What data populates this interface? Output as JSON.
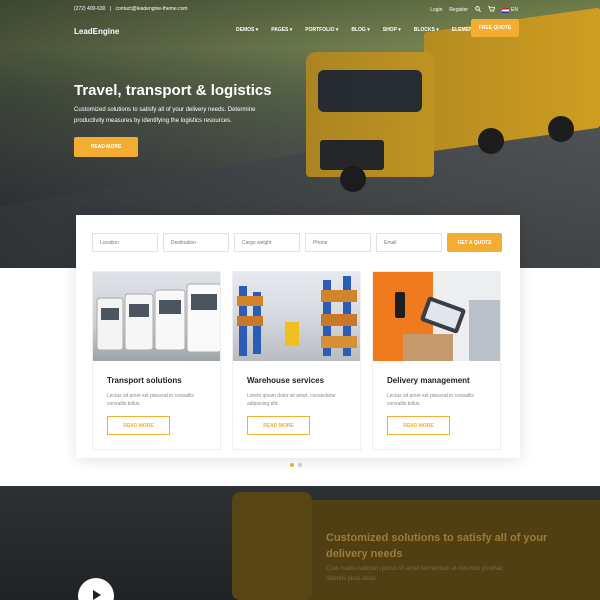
{
  "topbar": {
    "phone": "(272) 400-630",
    "email": "contact@leadengine-theme.com",
    "login": "Login",
    "register": "Register",
    "lang": "EN"
  },
  "nav": {
    "logo": "LeadEngine",
    "items": [
      "DEMOS",
      "PAGES",
      "PORTFOLIO",
      "BLOG",
      "SHOP",
      "BLOCKS",
      "ELEMENTS"
    ],
    "cta": "FREE QUOTE"
  },
  "hero": {
    "title": "Travel, transport & logistics",
    "subtitle": "Customized solutions to satisfy all of your delivery needs. Determine productivity measures by identifying the logistics resources.",
    "button": "READ MORE"
  },
  "quote_form": {
    "location": "Location",
    "destination": "Destination",
    "cargo_weight": "Cargo weight",
    "phone": "Phone",
    "email": "Email",
    "button": "GET A QUOTE"
  },
  "cards": [
    {
      "title": "Transport solutions",
      "text": "Lectus sit amet est placerat in convallis convallis tellus.",
      "button": "READ MORE"
    },
    {
      "title": "Warehouse services",
      "text": "Lorem ipsum dolor sit amet, consectetur adipiscing elit.",
      "button": "READ MORE"
    },
    {
      "title": "Delivery management",
      "text": "Lectus sit amet est placerat in convallis convallis tellus.",
      "button": "READ MORE"
    }
  ],
  "bottom": {
    "title": "Customized solutions to satisfy all of your delivery needs",
    "text": "Cras mattis iudicium purus sit amet fermentum at nos hinc posthac, sitientis piros afros."
  },
  "colors": {
    "accent": "#f4ad33"
  }
}
